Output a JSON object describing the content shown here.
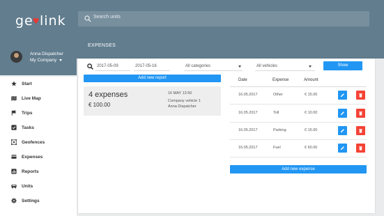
{
  "brand": {
    "logo_text": "geolink"
  },
  "search": {
    "placeholder": "Search units"
  },
  "page": {
    "section_title": "EXPENSES"
  },
  "user": {
    "name": "Anna Dispatcher",
    "company": "My Company"
  },
  "nav": [
    {
      "label": "Start",
      "icon": "star-icon"
    },
    {
      "label": "Live Map",
      "icon": "map-icon"
    },
    {
      "label": "Trips",
      "icon": "flag-icon"
    },
    {
      "label": "Tasks",
      "icon": "checkbox-icon"
    },
    {
      "label": "Geofences",
      "icon": "geofence-icon"
    },
    {
      "label": "Expenses",
      "icon": "card-icon"
    },
    {
      "label": "Reports",
      "icon": "chart-icon"
    },
    {
      "label": "Units",
      "icon": "truck-icon"
    },
    {
      "label": "Settings",
      "icon": "gear-icon"
    }
  ],
  "filters": {
    "date_from": "2017-05-09",
    "date_to": "2017-05-16",
    "category": "All categories",
    "vehicles": "All vehicles",
    "show_label": "Show",
    "add_report_label": "Add new report"
  },
  "report": {
    "count_text": "4 expenses",
    "total": "€ 100.00",
    "date": "16 MAY 13:50",
    "vehicle": "Company vehicle 1",
    "driver": "Anna Dispatcher"
  },
  "table": {
    "headers": [
      "Date",
      "Expense",
      "Amount"
    ],
    "rows": [
      {
        "date": "16.05.2017",
        "expense": "Other",
        "amount": "€ 15.00"
      },
      {
        "date": "16.05.2017",
        "expense": "Toll",
        "amount": "€ 10.00"
      },
      {
        "date": "16.05.2017",
        "expense": "Parking",
        "amount": "€ 15.00"
      },
      {
        "date": "16.05.2017",
        "expense": "Fuel",
        "amount": "€ 60.00"
      }
    ],
    "add_expense_label": "Add new expense"
  },
  "colors": {
    "header": "#617d8e",
    "accent": "#2196f3",
    "danger": "#f44336",
    "logo_heart": "#e53935"
  }
}
